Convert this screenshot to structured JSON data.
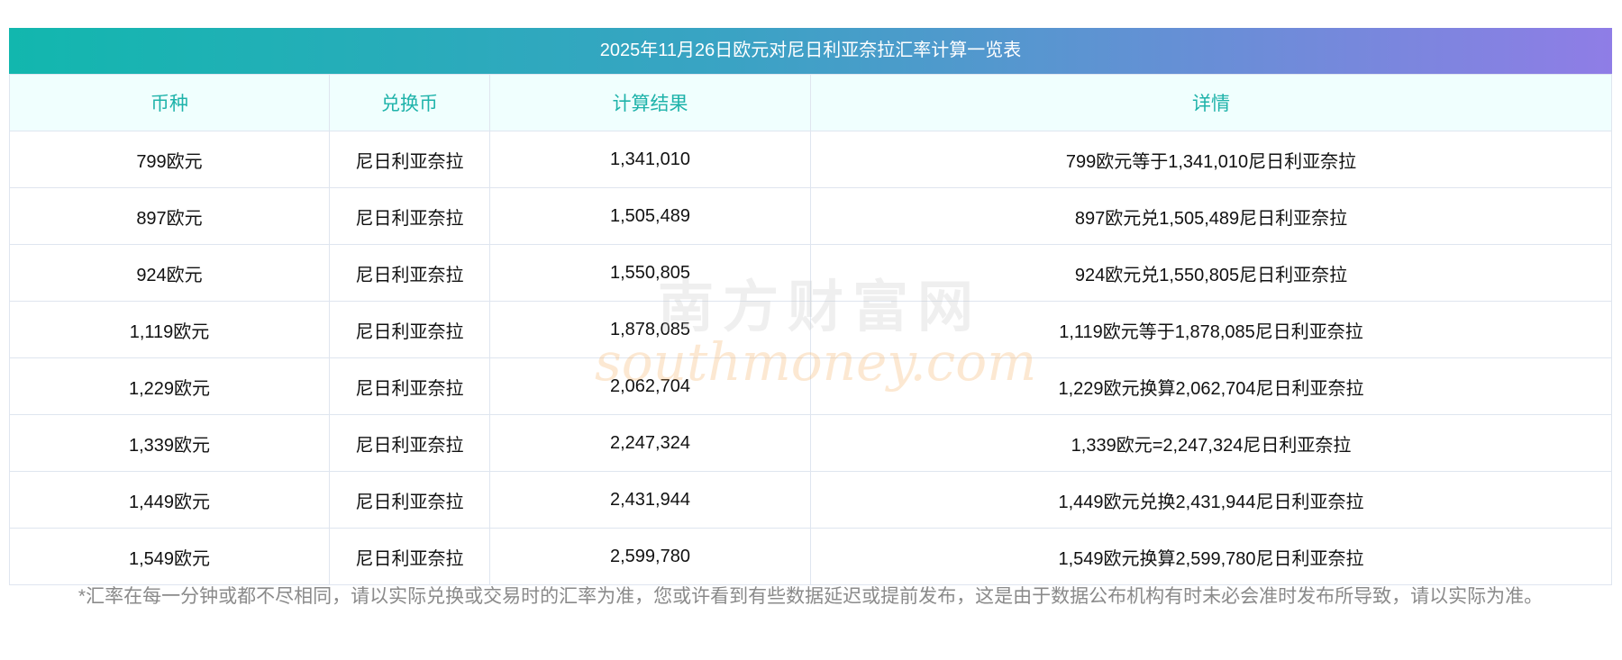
{
  "title": "2025年11月26日欧元对尼日利亚奈拉汇率计算一览表",
  "columns": [
    "币种",
    "兑换币",
    "计算结果",
    "详情"
  ],
  "rows": [
    [
      "799欧元",
      "尼日利亚奈拉",
      "1,341,010",
      "799欧元等于1,341,010尼日利亚奈拉"
    ],
    [
      "897欧元",
      "尼日利亚奈拉",
      "1,505,489",
      "897欧元兑1,505,489尼日利亚奈拉"
    ],
    [
      "924欧元",
      "尼日利亚奈拉",
      "1,550,805",
      "924欧元兑1,550,805尼日利亚奈拉"
    ],
    [
      "1,119欧元",
      "尼日利亚奈拉",
      "1,878,085",
      "1,119欧元等于1,878,085尼日利亚奈拉"
    ],
    [
      "1,229欧元",
      "尼日利亚奈拉",
      "2,062,704",
      "1,229欧元换算2,062,704尼日利亚奈拉"
    ],
    [
      "1,339欧元",
      "尼日利亚奈拉",
      "2,247,324",
      "1,339欧元=2,247,324尼日利亚奈拉"
    ],
    [
      "1,449欧元",
      "尼日利亚奈拉",
      "2,431,944",
      "1,449欧元兑换2,431,944尼日利亚奈拉"
    ],
    [
      "1,549欧元",
      "尼日利亚奈拉",
      "2,599,780",
      "1,549欧元换算2,599,780尼日利亚奈拉"
    ]
  ],
  "note": "*汇率在每一分钟或都不尽相同，请以实际兑换或交易时的汇率为准，您或许看到有些数据延迟或提前发布，这是由于数据公布机构有时未必会准时发布所导致，请以实际为准。",
  "watermark": {
    "cn": "南方财富网",
    "en": "southmoney.com"
  }
}
